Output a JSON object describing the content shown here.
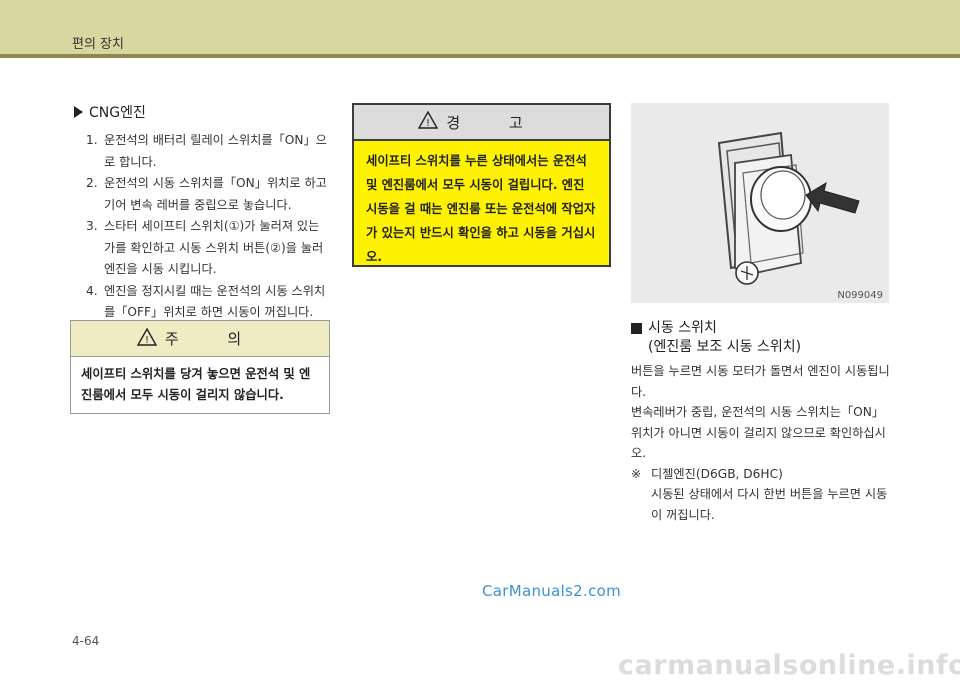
{
  "header": {
    "title": "편의 장치"
  },
  "left": {
    "section_title": "CNG엔진",
    "steps": [
      {
        "num": "1.",
        "text": "운전석의 배터리 릴레이 스위치를「ON」으로 합니다."
      },
      {
        "num": "2.",
        "text": "운전석의 시동 스위치를「ON」위치로 하고 기어 변속 레버를 중립으로 놓습니다."
      },
      {
        "num": "3.",
        "text": "스타터 세이프티 스위치(①)가 눌러져 있는가를 확인하고 시동 스위치 버튼(②)을 눌러 엔진을 시동 시킵니다."
      },
      {
        "num": "4.",
        "text": "엔진을 정지시킬 때는 운전석의 시동 스위치를「OFF」위치로 하면 시동이 꺼집니다."
      }
    ]
  },
  "caution": {
    "title": "주 의",
    "body": "세이프티 스위치를 당겨 놓으면 운전석 및 엔진룸에서 모두 시동이 걸리지 않습니다."
  },
  "warning": {
    "title": "경 고",
    "body": "세이프티 스위치를 누른 상태에서는 운전석 및 엔진룸에서 모두 시동이 걸립니다. 엔진 시동을 걸 때는 엔진룸 또는 운전석에 작업자가 있는지 반드시 확인을 하고 시동을 거십시오."
  },
  "figure": {
    "code": "N099049"
  },
  "right": {
    "subsection_title_1": "시동 스위치",
    "subsection_title_2": "(엔진룸 보조 시동 스위치)",
    "para1": "버튼을 누르면 시동 모터가 돌면서 엔진이 시동됩니다.",
    "para2": "변속레버가 중립, 운전석의 시동 스위치는「ON」위치가 아니면 시동이 걸리지 않으므로 확인하십시오.",
    "note_mark": "※",
    "note_title": "디젤엔진(D6GB, D6HC)",
    "note_body": "시동된 상태에서 다시 한번 버튼을 누르면 시동이 꺼집니다."
  },
  "watermark": "CarManuals2.com",
  "page_number": "4-64",
  "footer_watermark": "carmanualsonline.info"
}
